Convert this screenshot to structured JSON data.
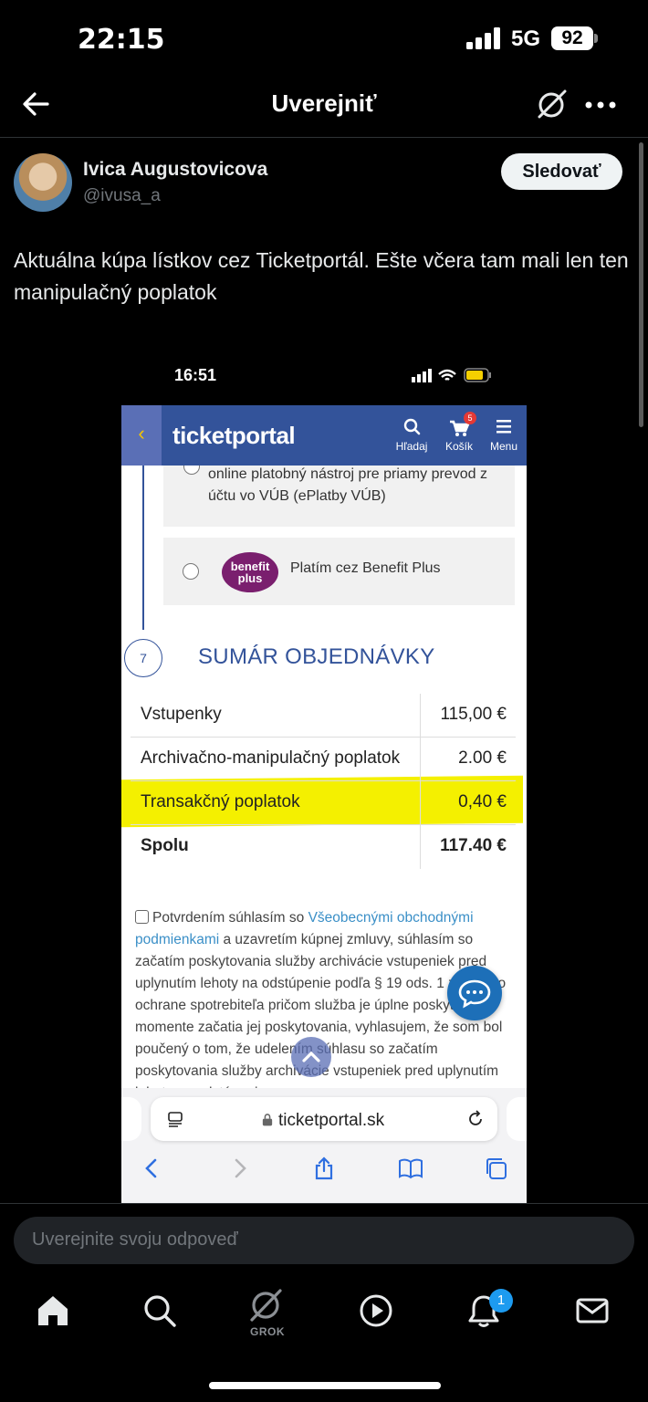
{
  "status_bar": {
    "time": "22:15",
    "network": "5G",
    "battery": "92"
  },
  "header": {
    "title": "Uverejniť"
  },
  "post": {
    "author_name": "Ivica Augustovicova",
    "author_handle": "@ivusa_a",
    "follow_label": "Sledovať",
    "text": "Aktuálna kúpa lístkov cez Ticketportál. Ešte včera tam mali len ten manipulačný poplatok"
  },
  "embedded": {
    "status_time": "16:51",
    "brand": "ticketportal",
    "nav": {
      "search": "Hľadaj",
      "cart": "Košík",
      "cart_count": "5",
      "menu": "Menu"
    },
    "payment_option_1": "online platobný nástroj pre priamy prevod z účtu vo VÚB (ePlatby VÚB)",
    "benefit_logo": "benefit plus",
    "payment_option_2": "Platím cez Benefit Plus",
    "step_number": "7",
    "summary_title": "SUMÁR OBJEDNÁVKY",
    "summary_rows": [
      {
        "label": "Vstupenky",
        "value": "115,00 €"
      },
      {
        "label": "Archivačno-manipulačný poplatok",
        "value": "2.00 €"
      },
      {
        "label": "Transakčný poplatok",
        "value": "0,40 €"
      },
      {
        "label": "Spolu",
        "value": "117.40 €"
      }
    ],
    "terms_prefix": "Potvrdením súhlasím so ",
    "terms_link": "Všeobecnými obchodnými podmienkami",
    "terms_rest": " a uzavretím kúpnej zmluvy, súhlasím so začatím poskytovania služby archivácie vstupeniek pred uplynutím lehoty na odstúpenie podľa § 19 ods. 1 zákona o ochrane spotrebiteľa pričom služba je úplne poskytnutá v momente začatia jej poskytovania, vyhlasujem, že som bol poučený o tom, že udelením súhlasu so začatím poskytovania služby archivácie vstupeniek pred uplynutím lehoty na odstúpenie",
    "url": "ticketportal.sk"
  },
  "reply_placeholder": "Uverejnite svoju odpoveď",
  "tabbar": {
    "grok_label": "GROK",
    "notifications_count": "1"
  },
  "colors": {
    "accent": "#1d9bf0",
    "ticketportal_blue": "#33539a",
    "highlight": "#f4f000"
  }
}
